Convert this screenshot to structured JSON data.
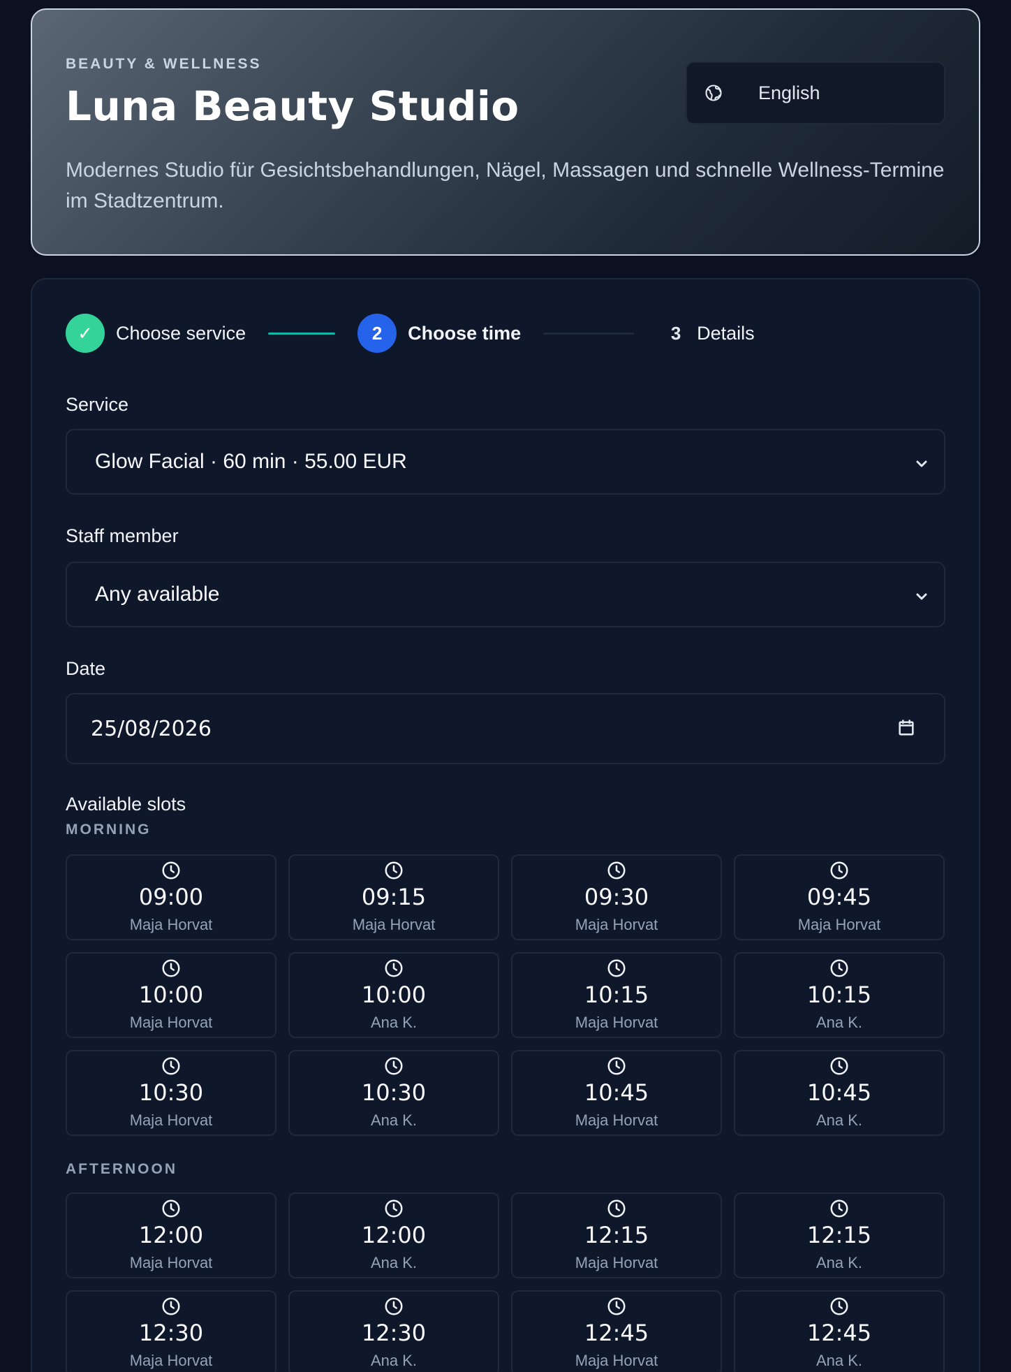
{
  "header": {
    "eyebrow": "BEAUTY & WELLNESS",
    "title": "Luna Beauty Studio",
    "description": "Modernes Studio für Gesichtsbehandlungen, Nägel, Massagen und schnelle Wellness-Termine im Stadtzentrum.",
    "language": {
      "icon": "globe-icon",
      "label": "English"
    }
  },
  "stepper": {
    "steps": [
      {
        "marker": "✓",
        "label": "Choose service",
        "state": "done"
      },
      {
        "marker": "2",
        "label": "Choose time",
        "state": "active"
      },
      {
        "marker": "3",
        "label": "Details",
        "state": "pending"
      }
    ]
  },
  "form": {
    "service": {
      "label": "Service",
      "value": "Glow Facial · 60 min · 55.00 EUR"
    },
    "staff": {
      "label": "Staff member",
      "value": "Any available"
    },
    "date": {
      "label": "Date",
      "value": "25/08/2026"
    }
  },
  "slots": {
    "title": "Available slots",
    "morning": {
      "label": "MORNING",
      "items": [
        {
          "time": "09:00",
          "staff": "Maja Horvat"
        },
        {
          "time": "09:15",
          "staff": "Maja Horvat"
        },
        {
          "time": "09:30",
          "staff": "Maja Horvat"
        },
        {
          "time": "09:45",
          "staff": "Maja Horvat"
        },
        {
          "time": "10:00",
          "staff": "Maja Horvat"
        },
        {
          "time": "10:00",
          "staff": "Ana K."
        },
        {
          "time": "10:15",
          "staff": "Maja Horvat"
        },
        {
          "time": "10:15",
          "staff": "Ana K."
        },
        {
          "time": "10:30",
          "staff": "Maja Horvat"
        },
        {
          "time": "10:30",
          "staff": "Ana K."
        },
        {
          "time": "10:45",
          "staff": "Maja Horvat"
        },
        {
          "time": "10:45",
          "staff": "Ana K."
        }
      ]
    },
    "afternoon": {
      "label": "AFTERNOON",
      "items": [
        {
          "time": "12:00",
          "staff": "Maja Horvat"
        },
        {
          "time": "12:00",
          "staff": "Ana K."
        },
        {
          "time": "12:15",
          "staff": "Maja Horvat"
        },
        {
          "time": "12:15",
          "staff": "Ana K."
        },
        {
          "time": "12:30",
          "staff": "Maja Horvat"
        },
        {
          "time": "12:30",
          "staff": "Ana K."
        },
        {
          "time": "12:45",
          "staff": "Maja Horvat"
        },
        {
          "time": "12:45",
          "staff": "Ana K."
        }
      ]
    }
  },
  "colors": {
    "background": "#0b1120",
    "card": "#0f172a",
    "step_done": "#34d399",
    "step_active": "#2563eb",
    "connector_done": "#14b8a6"
  }
}
